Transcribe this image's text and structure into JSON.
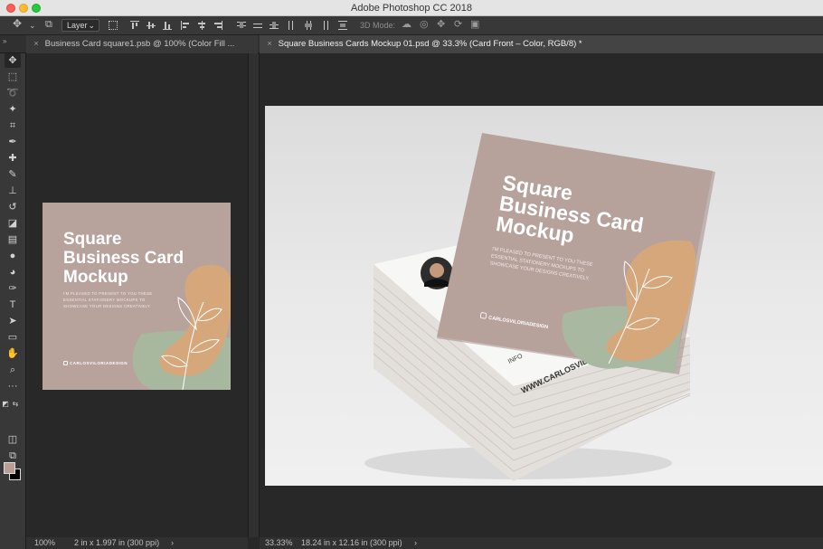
{
  "window": {
    "title": "Adobe Photoshop CC 2018"
  },
  "options_bar": {
    "auto_select_value": "Layer",
    "mode_label": "3D Mode:"
  },
  "tabs": [
    {
      "label": "Business Card square1.psb @ 100% (Color Fill ..."
    },
    {
      "label": "Square Business Cards Mockup 01.psd @ 33.3% (Card Front – Color, RGB/8) *"
    }
  ],
  "tools": [
    {
      "name": "move-tool",
      "glyph": "✥"
    },
    {
      "name": "marquee-tool",
      "glyph": "⬚"
    },
    {
      "name": "lasso-tool",
      "glyph": "➰"
    },
    {
      "name": "magic-wand-tool",
      "glyph": "✦"
    },
    {
      "name": "crop-tool",
      "glyph": "⌗"
    },
    {
      "name": "eyedropper-tool",
      "glyph": "✒"
    },
    {
      "name": "healing-brush-tool",
      "glyph": "✚"
    },
    {
      "name": "brush-tool",
      "glyph": "✎"
    },
    {
      "name": "clone-stamp-tool",
      "glyph": "⊥"
    },
    {
      "name": "history-brush-tool",
      "glyph": "↺"
    },
    {
      "name": "eraser-tool",
      "glyph": "◪"
    },
    {
      "name": "gradient-tool",
      "glyph": "▤"
    },
    {
      "name": "blur-tool",
      "glyph": "●"
    },
    {
      "name": "dodge-tool",
      "glyph": "◕"
    },
    {
      "name": "pen-tool",
      "glyph": "✑"
    },
    {
      "name": "type-tool",
      "glyph": "T"
    },
    {
      "name": "path-selection-tool",
      "glyph": "➤"
    },
    {
      "name": "rectangle-tool",
      "glyph": "▭"
    },
    {
      "name": "hand-tool",
      "glyph": "✋"
    },
    {
      "name": "zoom-tool",
      "glyph": "⌕"
    },
    {
      "name": "more-tools",
      "glyph": "···"
    }
  ],
  "colors": {
    "foreground": "#ba9d94",
    "background": "#000000"
  },
  "card": {
    "title_line1": "Square",
    "title_line2": "Business Card",
    "title_line3": "Mockup",
    "body_line1": "I'M PLEASED TO PRESENT TO YOU THESE",
    "body_line2": "ESSENTIAL STATIONERY MOCKUPS TO",
    "body_line3": "SHOWCASE YOUR DESIGNS CREATIVELY.",
    "handle": "CARLOSVILORIADESIGN",
    "back_website": "WWW.CARLOSVILO",
    "back_info": "INFO"
  },
  "status": {
    "doc1_zoom": "100%",
    "doc1_size": "2 in x 1.997 in (300 ppi)",
    "doc2_zoom": "33.33%",
    "doc2_size": "18.24 in x 12.16 in (300 ppi)"
  }
}
